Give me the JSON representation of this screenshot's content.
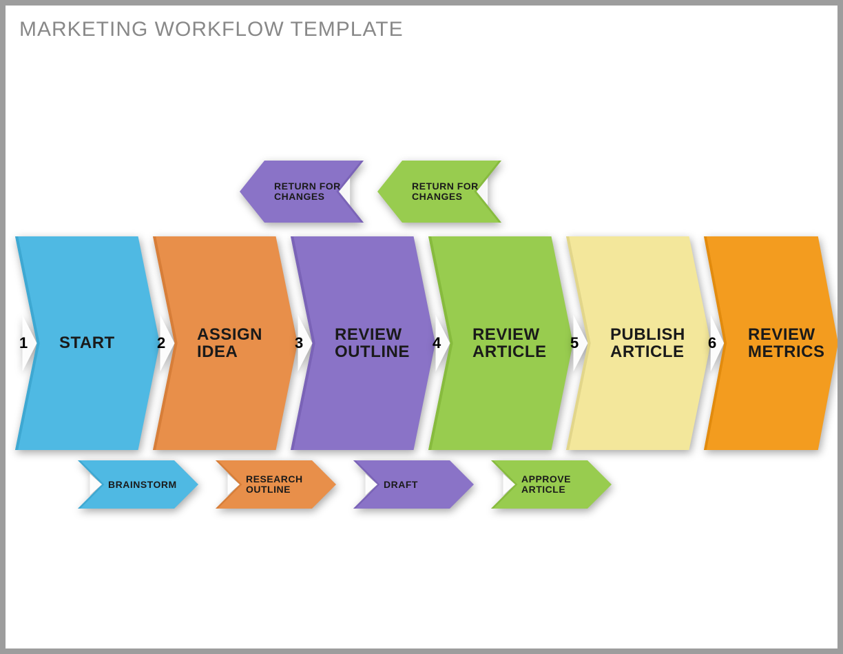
{
  "title": "MARKETING WORKFLOW TEMPLATE",
  "steps": [
    {
      "num": "1",
      "label": "START"
    },
    {
      "num": "2",
      "label": "ASSIGN IDEA"
    },
    {
      "num": "3",
      "label": "REVIEW OUTLINE"
    },
    {
      "num": "4",
      "label": "REVIEW ARTICLE"
    },
    {
      "num": "5",
      "label": "PUBLISH ARTICLE"
    },
    {
      "num": "6",
      "label": "REVIEW METRICS"
    }
  ],
  "returns": [
    {
      "label": "RETURN FOR CHANGES"
    },
    {
      "label": "RETURN FOR CHANGES"
    }
  ],
  "forwards": [
    {
      "label": "BRAINSTORM"
    },
    {
      "label": "RESEARCH OUTLINE"
    },
    {
      "label": "DRAFT"
    },
    {
      "label": "APPROVE ARTICLE"
    }
  ],
  "colors": {
    "c1": "#4fb9e3",
    "c2": "#e88f4a",
    "c3": "#8a73c7",
    "c4": "#98cc4f",
    "c5": "#f3e79b",
    "c6": "#f39c1f"
  }
}
